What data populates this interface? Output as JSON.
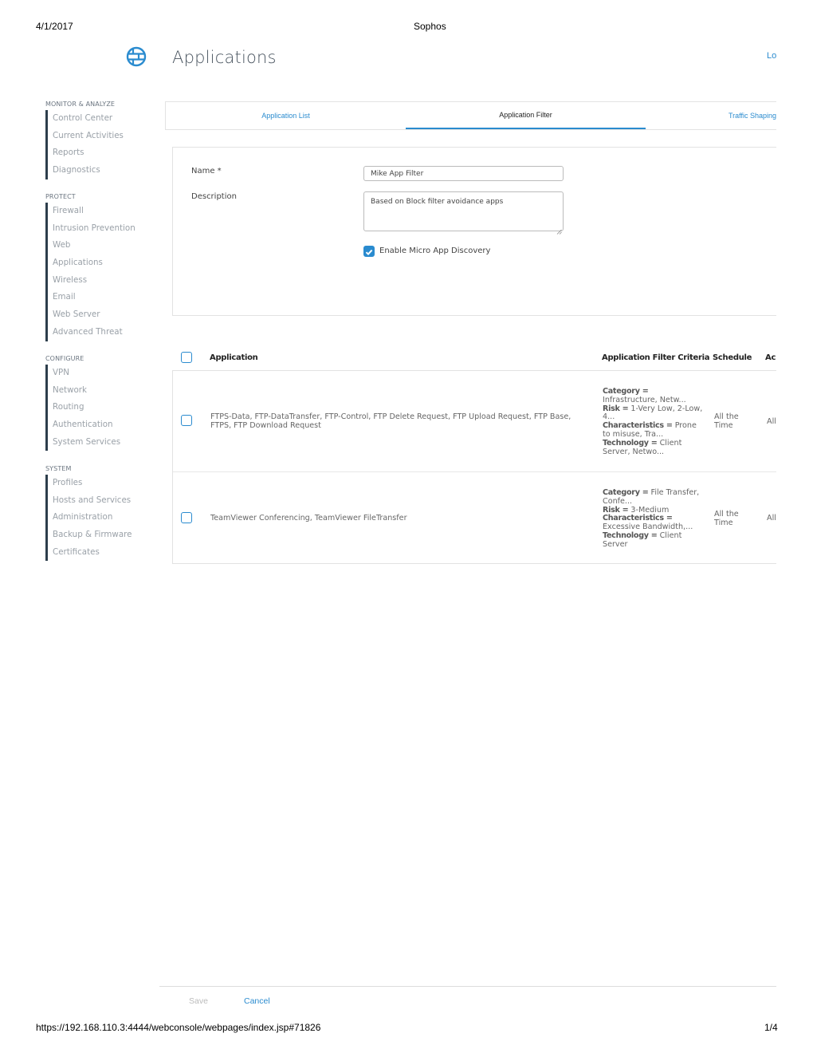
{
  "print_header": {
    "date": "4/1/2017",
    "title": "Sophos"
  },
  "print_footer": {
    "url": "https://192.168.110.3:4444/webconsole/webpages/index.jsp#71826",
    "page": "1/4"
  },
  "header": {
    "title": "Applications",
    "icon": "firewall-globe-icon",
    "top_right_link": "Lo"
  },
  "sidebar": {
    "groups": [
      {
        "heading": "MONITOR & ANALYZE",
        "items": [
          "Control Center",
          "Current Activities",
          "Reports",
          "Diagnostics"
        ]
      },
      {
        "heading": "PROTECT",
        "items": [
          "Firewall",
          "Intrusion Prevention",
          "Web",
          "Applications",
          "Wireless",
          "Email",
          "Web Server",
          "Advanced Threat"
        ]
      },
      {
        "heading": "CONFIGURE",
        "items": [
          "VPN",
          "Network",
          "Routing",
          "Authentication",
          "System Services"
        ]
      },
      {
        "heading": "SYSTEM",
        "items": [
          "Profiles",
          "Hosts and Services",
          "Administration",
          "Backup & Firmware",
          "Certificates"
        ]
      }
    ]
  },
  "tabs": [
    {
      "label": "Application List",
      "active": false
    },
    {
      "label": "Application Filter",
      "active": true
    },
    {
      "label": "Traffic Shaping",
      "active": false
    }
  ],
  "form": {
    "name_label": "Name *",
    "name_value": "Mike App Filter",
    "description_label": "Description",
    "description_value": "Based on Block filter avoidance apps",
    "micro_app_label": "Enable Micro App Discovery",
    "micro_app_checked": true
  },
  "table": {
    "columns": [
      "Application",
      "Application Filter Criteria",
      "Schedule",
      "Ac"
    ],
    "rows": [
      {
        "application": "FTPS-Data, FTP-DataTransfer, FTP-Control, FTP Delete Request, FTP Upload Request, FTP Base, FTPS, FTP Download Request",
        "criteria": [
          {
            "key": "Category =",
            "value": "Infrastructure, Netw..."
          },
          {
            "key": "Risk =",
            "value": "1-Very Low, 2-Low, 4..."
          },
          {
            "key": "Characteristics =",
            "value": "Prone to misuse, Tra..."
          },
          {
            "key": "Technology =",
            "value": "Client Server, Netwo..."
          }
        ],
        "schedule": "All the Time",
        "action": "All"
      },
      {
        "application": "TeamViewer Conferencing, TeamViewer FileTransfer",
        "criteria": [
          {
            "key": "Category =",
            "value": "File Transfer, Confe..."
          },
          {
            "key": "Risk =",
            "value": "3-Medium"
          },
          {
            "key": "Characteristics =",
            "value": "Excessive Bandwidth,..."
          },
          {
            "key": "Technology =",
            "value": "Client Server"
          }
        ],
        "schedule": "All the Time",
        "action": "All"
      }
    ]
  },
  "actions": {
    "save": "Save",
    "cancel": "Cancel"
  },
  "colors": {
    "accent": "#2a8bcf",
    "sidebar_bar": "#2d3e4c",
    "nav_text": "#9aa1a8"
  }
}
